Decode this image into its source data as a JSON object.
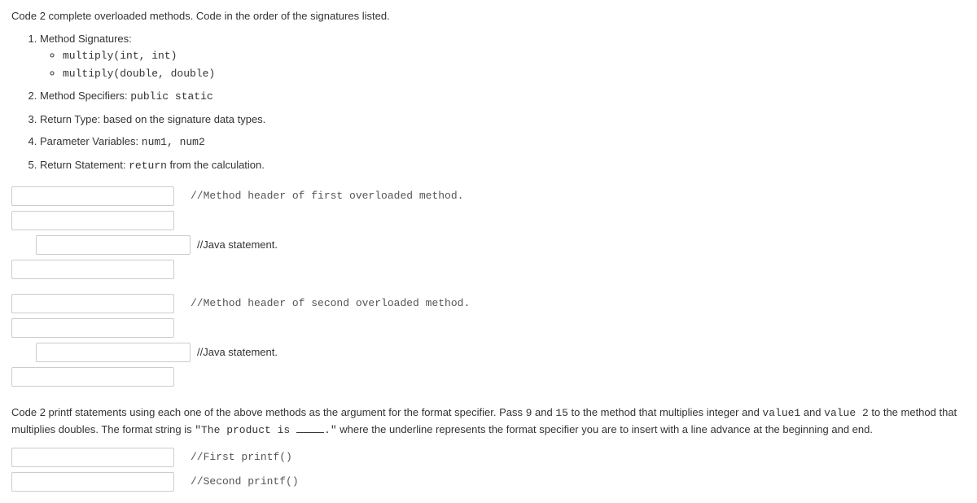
{
  "intro": "Code 2 complete overloaded methods.  Code in the order of the signatures listed.",
  "list": {
    "item1": {
      "label": "Method Signatures:",
      "sub1": "multiply(int, int)",
      "sub2": "multiply(double, double)"
    },
    "item2": {
      "label": "Method Specifiers: ",
      "value": "public static"
    },
    "item3": {
      "label": "Return Type:",
      "rest": "  based on the signature data types."
    },
    "item4": {
      "label": "Parameter Variables: ",
      "value": "num1, num2"
    },
    "item5": {
      "label": "Return Statement: ",
      "code": "return",
      "rest": " from the calculation."
    }
  },
  "comments": {
    "c1": "//Method header of first overloaded method.",
    "c2": "//Java statement.",
    "c3": "//Method header of second overloaded method.",
    "c4": "//Java statement.",
    "c5": "//First printf()",
    "c6": "//Second printf()"
  },
  "section2": {
    "p1a": "Code 2 printf statements using each one of the above methods as the argument for the format specifier.  Pass ",
    "v9": "9",
    "p1b": " and ",
    "v15": "15",
    "p1c": " to the method that multiplies integer and ",
    "vv1": "value1",
    "p1d": " and ",
    "vv2": "value 2",
    "p1e": " to the method that multiplies doubles.  The format string is ",
    "fmt": "\"The product is ",
    "fmt2": ".\"",
    "p1f": "  where the underline represents the format specifier you are to insert with a line advance at the beginning and end."
  }
}
